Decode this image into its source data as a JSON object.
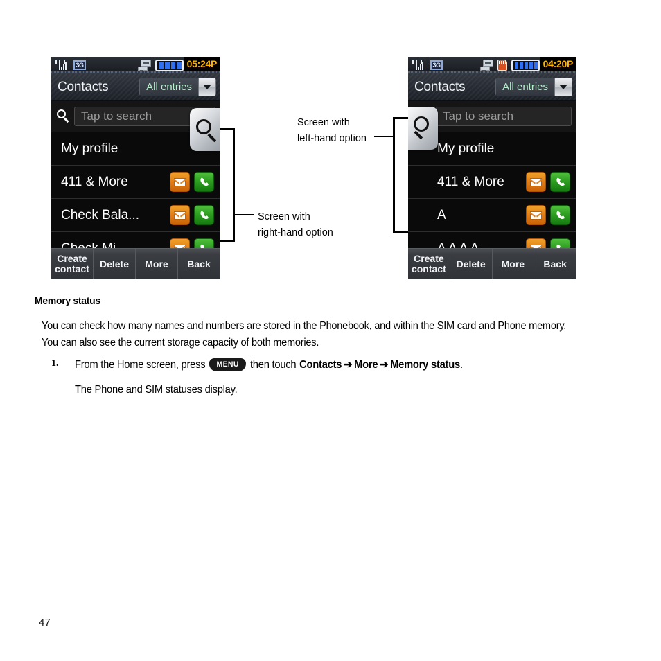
{
  "page": {
    "number": "47"
  },
  "figure": {
    "callouts": [
      {
        "id": "left-hand",
        "line1": "Screen with",
        "line2": "left-hand option"
      },
      {
        "id": "right-hand",
        "line1": "Screen with",
        "line2": "right-hand option"
      }
    ],
    "screens": [
      {
        "id": "right-hand-option",
        "status_bar": {
          "icons": [
            "signal-icon",
            "3g-icon",
            "pc-sync-icon"
          ],
          "battery_bars": 4,
          "time": "05:24P"
        },
        "title": "Contacts",
        "filter_value": "All entries",
        "search_placeholder": "Tap to search",
        "search_tab_side": "right",
        "rows": [
          {
            "label": "My profile",
            "actions": []
          },
          {
            "label": "411 & More",
            "actions": [
              "message-icon",
              "call-icon"
            ]
          },
          {
            "label": "Check Bala...",
            "actions": [
              "message-icon",
              "call-icon"
            ]
          },
          {
            "label": "Check Mi",
            "actions": [
              "message-icon",
              "call-icon"
            ]
          }
        ],
        "softkeys": [
          "Create contact",
          "Delete",
          "More",
          "Back"
        ]
      },
      {
        "id": "left-hand-option",
        "status_bar": {
          "icons": [
            "signal-icon",
            "3g-icon",
            "pc-sync-icon",
            "sim-card-icon"
          ],
          "battery_bars": 5,
          "time": "04:20P"
        },
        "title": "Contacts",
        "filter_value": "All entries",
        "search_placeholder": "Tap to search",
        "search_tab_side": "left",
        "rows": [
          {
            "label": "My profile",
            "actions": []
          },
          {
            "label": "411 & More",
            "actions": [
              "message-icon",
              "call-icon"
            ]
          },
          {
            "label": "A",
            "actions": [
              "message-icon",
              "call-icon"
            ]
          },
          {
            "label": "A A A A",
            "actions": [
              "message-icon",
              "call-icon"
            ]
          }
        ],
        "softkeys": [
          "Create contact",
          "Delete",
          "More",
          "Back"
        ]
      }
    ]
  },
  "content": {
    "heading": "Memory status",
    "paragraph": "You can check how many names and numbers are stored in the Phonebook, and within the SIM card and Phone memory. You can also see the current storage capacity of both memories.",
    "step": {
      "number": "1.",
      "text_before_key": "From the Home screen, press",
      "key_label": "MENU",
      "text_after_key": "then touch",
      "path": [
        "Contacts",
        "More",
        "Memory status"
      ],
      "arrow": "➔",
      "period": ".",
      "result": "The Phone and SIM statuses display."
    }
  },
  "colors": {
    "status_time": "#ffb400",
    "filter_value": "#b8f0cf",
    "message_icon": "#e3801a",
    "call_icon": "#2f9f23",
    "battery": "#2f6ff0"
  }
}
